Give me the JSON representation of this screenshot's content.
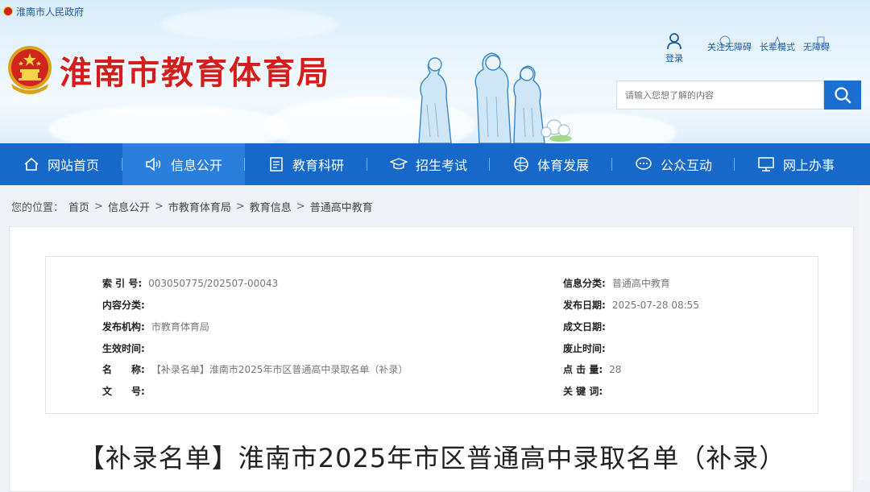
{
  "header": {
    "gov_link": "淮南市人民政府",
    "site_title": "淮南市教育体育局",
    "login_label": "登录",
    "links": [
      {
        "label": "关注无障碍",
        "icon": "accessibility-icon"
      },
      {
        "label": "长辈模式",
        "icon": "elder-mode-icon"
      },
      {
        "label": "无障碍",
        "icon": "barrier-free-icon"
      }
    ],
    "search_placeholder": "请输入您想了解的内容"
  },
  "nav": {
    "items": [
      {
        "label": "网站首页",
        "icon": "home-icon"
      },
      {
        "label": "信息公开",
        "icon": "speaker-icon",
        "active": true
      },
      {
        "label": "教育科研",
        "icon": "document-icon"
      },
      {
        "label": "招生考试",
        "icon": "graduation-cap-icon"
      },
      {
        "label": "体育发展",
        "icon": "ball-icon"
      },
      {
        "label": "公众互动",
        "icon": "chat-icon"
      },
      {
        "label": "网上办事",
        "icon": "monitor-icon"
      }
    ]
  },
  "breadcrumb": {
    "prefix": "您的位置：",
    "items": [
      "首页",
      "信息公开",
      "市教育体育局",
      "教育信息",
      "普通高中教育"
    ]
  },
  "meta": {
    "left": [
      {
        "key": "索 引 号:",
        "value": "003050775/202507-00043"
      },
      {
        "key": "内容分类:",
        "value": ""
      },
      {
        "key": "发布机构:",
        "value": "市教育体育局"
      },
      {
        "key": "生效时间:",
        "value": ""
      },
      {
        "key": "名　　称:",
        "value": "【补录名单】淮南市2025年市区普通高中录取名单（补录）"
      },
      {
        "key": "文　　号:",
        "value": ""
      }
    ],
    "right": [
      {
        "key": "信息分类:",
        "value": "普通高中教育"
      },
      {
        "key": "发布日期:",
        "value": "2025-07-28 08:55"
      },
      {
        "key": "成文日期:",
        "value": ""
      },
      {
        "key": "废止时间:",
        "value": ""
      },
      {
        "key": "点 击 量:",
        "value": "28"
      },
      {
        "key": "关 键 词:",
        "value": ""
      }
    ]
  },
  "article": {
    "title": "【补录名单】淮南市2025年市区普通高中录取名单（补录）"
  },
  "colors": {
    "nav_bg": "#1668c9",
    "nav_active": "#2a7fdc",
    "title_red": "#d41d1d",
    "search_button": "#1a6fd1"
  }
}
